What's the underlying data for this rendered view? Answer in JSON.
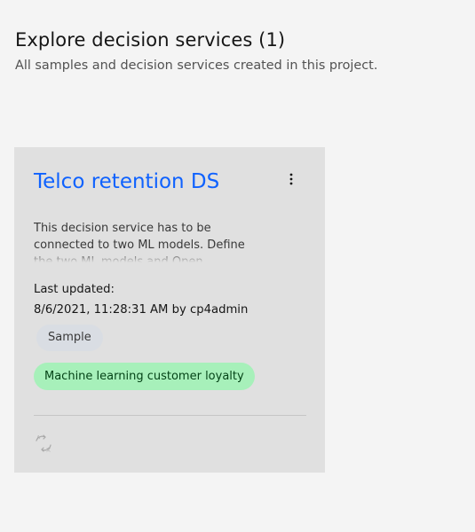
{
  "header": {
    "title": "Explore decision services (1)",
    "subtitle": "All samples and decision services created in this project."
  },
  "card": {
    "title": "Telco retention DS",
    "overflow_icon": "overflow-menu-vertical",
    "description": "This decision service has to be connected to two ML models. Define the two ML models and Open",
    "last_updated_label": "Last updated:",
    "last_updated_value": "8/6/2021, 11:28:31 AM by cp4admin",
    "tags": [
      "Sample",
      "Machine learning customer loyalty"
    ],
    "footer_icon": "translate-icon"
  },
  "colors": {
    "background": "#f4f4f4",
    "card": "#e0e0e0",
    "link": "#0f62fe",
    "tag_gray": "#d9dde3",
    "tag_green": "#a7f0ba",
    "tag_green_text": "#044317"
  }
}
